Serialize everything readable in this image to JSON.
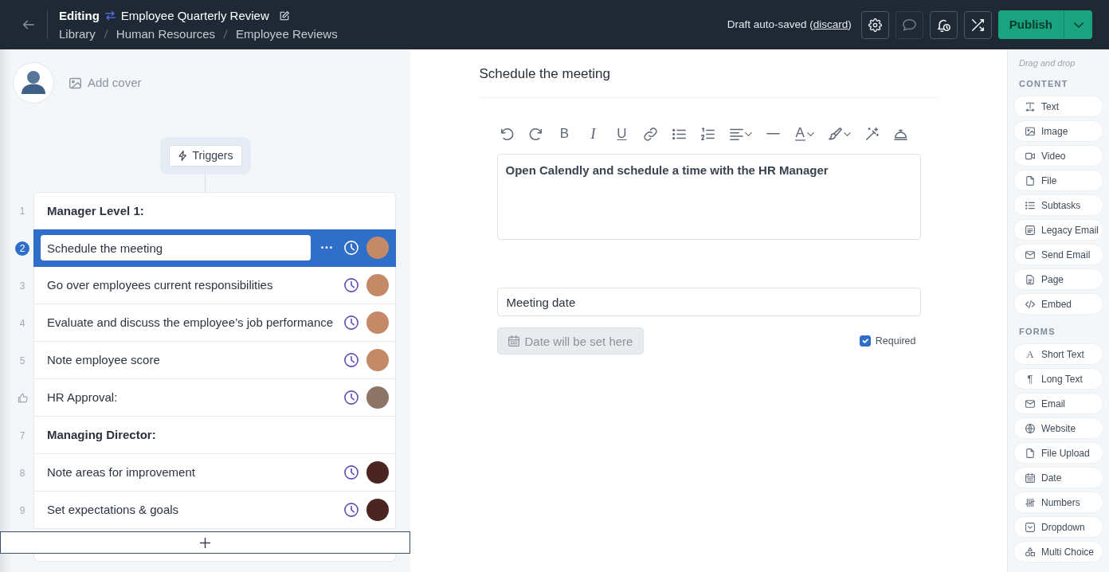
{
  "header": {
    "mode": "Editing",
    "title": "Employee Quarterly Review",
    "breadcrumb": [
      {
        "label": "Library"
      },
      {
        "label": "Human Resources"
      },
      {
        "label": "Employee Reviews"
      }
    ],
    "autosave": {
      "text": "Draft auto-saved (",
      "link": "discard",
      "tail": ")"
    },
    "actions": [
      {
        "kind": "settings",
        "disabled": false
      },
      {
        "kind": "comments",
        "disabled": true
      },
      {
        "kind": "reminders",
        "disabled": false
      },
      {
        "kind": "shuffle",
        "disabled": false
      }
    ],
    "publish": {
      "label": "Publish"
    }
  },
  "steps_panel": {
    "add_cover": "Add cover",
    "triggers": "Triggers",
    "steps": [
      {
        "number": "1",
        "kind": "heading",
        "title": "Manager Level 1:",
        "selected": false
      },
      {
        "number": "2",
        "kind": "task",
        "title": "Schedule the meeting",
        "selected": true,
        "color": "#c48a68"
      },
      {
        "number": "3",
        "kind": "task",
        "title": "Go over employees current responsibilities",
        "selected": false,
        "color": "#c48a68"
      },
      {
        "number": "4",
        "kind": "task",
        "title": "Evaluate and discuss the employee’s job performance",
        "selected": false,
        "color": "#c48a68"
      },
      {
        "number": "5",
        "kind": "task",
        "title": "Note employee score",
        "selected": false,
        "color": "#c48a68"
      },
      {
        "kind": "approval",
        "title": "HR Approval:",
        "selected": false,
        "color": "#8c7467"
      },
      {
        "number": "7",
        "kind": "heading",
        "title": "Managing Director:",
        "selected": false
      },
      {
        "number": "8",
        "kind": "task",
        "title": "Note areas for improvement",
        "selected": false,
        "color": "#4a2522"
      },
      {
        "number": "9",
        "kind": "task",
        "title": "Set expectations & goals",
        "selected": false,
        "color": "#4a2522"
      }
    ]
  },
  "step_editor": {
    "title": "Schedule the meeting",
    "toolbar": [
      {
        "kind": "undo"
      },
      {
        "kind": "redo"
      },
      {
        "kind": "bold",
        "glyph": "B"
      },
      {
        "kind": "italic",
        "glyph": "I"
      },
      {
        "kind": "underline",
        "glyph": "U"
      },
      {
        "kind": "link"
      },
      {
        "kind": "bullet_list"
      },
      {
        "kind": "numbered_list"
      },
      {
        "kind": "align",
        "menu": true
      },
      {
        "kind": "divider"
      },
      {
        "kind": "text_color",
        "glyph": "A",
        "menu": true
      },
      {
        "kind": "highlight",
        "menu": true
      },
      {
        "kind": "magic"
      },
      {
        "kind": "bell"
      }
    ],
    "body": "Open Calendly and schedule a time with the HR Manager",
    "field": {
      "label": "Meeting date",
      "placeholder": "Date will be set here",
      "disabled": true,
      "required": true,
      "required_label": "Required"
    }
  },
  "blocks_panel": {
    "hint": "Drag and drop",
    "groups": [
      {
        "title": "CONTENT",
        "items": [
          {
            "kind": "text",
            "label": "Text"
          },
          {
            "kind": "image",
            "label": "Image"
          },
          {
            "kind": "video",
            "label": "Video"
          },
          {
            "kind": "file",
            "label": "File"
          },
          {
            "kind": "subtasks",
            "label": "Subtasks"
          },
          {
            "kind": "legacy_email",
            "label": "Legacy Email"
          },
          {
            "kind": "send_email",
            "label": "Send Email"
          },
          {
            "kind": "page",
            "label": "Page"
          },
          {
            "kind": "embed",
            "label": "Embed"
          }
        ]
      },
      {
        "title": "FORMS",
        "items": [
          {
            "kind": "short_text",
            "glyph": "A",
            "label": "Short Text"
          },
          {
            "kind": "long_text",
            "glyph": "¶",
            "label": "Long Text"
          },
          {
            "kind": "email",
            "label": "Email"
          },
          {
            "kind": "website",
            "label": "Website"
          },
          {
            "kind": "file_upload",
            "label": "File Upload"
          },
          {
            "kind": "date",
            "label": "Date"
          },
          {
            "kind": "numbers",
            "label": "Numbers"
          },
          {
            "kind": "dropdown",
            "label": "Dropdown"
          },
          {
            "kind": "multi_choice",
            "label": "Multi Choice"
          }
        ]
      }
    ]
  }
}
